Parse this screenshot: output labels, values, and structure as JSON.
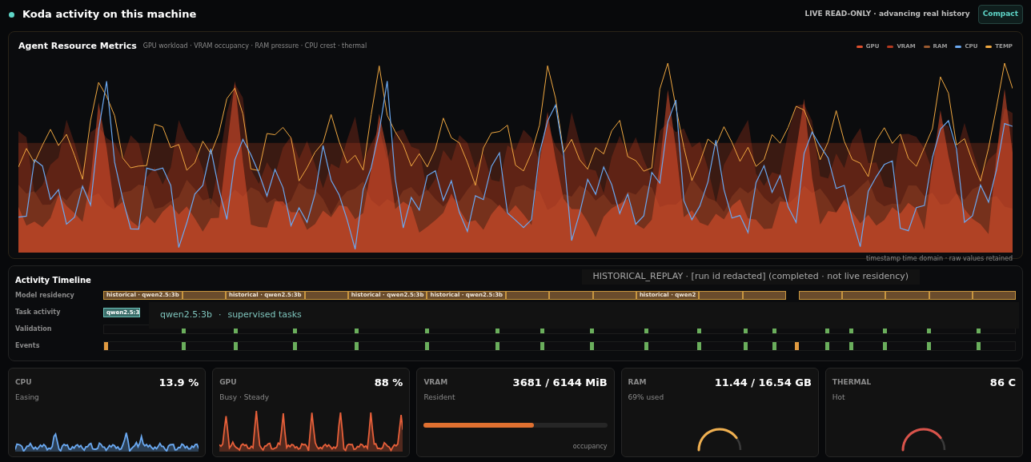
{
  "header": {
    "title": "Koda activity on this machine",
    "status": "LIVE READ-ONLY · advancing real history",
    "compact_button": "Compact"
  },
  "metrics": {
    "title": "Agent Resource Metrics",
    "subtitle": "GPU workload · VRAM occupancy · RAM pressure · CPU crest · thermal",
    "legend": [
      {
        "label": "GPU",
        "color": "#e0502e"
      },
      {
        "label": "VRAM",
        "color": "#b5391f"
      },
      {
        "label": "RAM",
        "color": "#9a5a30"
      },
      {
        "label": "CPU",
        "color": "#6aa8f0"
      },
      {
        "label": "TEMP",
        "color": "#f0a840"
      }
    ],
    "footnote": "timestamp time domain · raw values retained"
  },
  "timeline": {
    "title": "Activity Timeline",
    "replay_badge": "HISTORICAL_REPLAY · [run id redacted] (completed · not live residency)",
    "rows": [
      "Model residency",
      "Task activity",
      "Validation",
      "Events"
    ],
    "residency_segments": [
      {
        "kind": "labeled",
        "label": "historical · qwen2.5:3b"
      },
      {
        "kind": "plain"
      },
      {
        "kind": "labeled",
        "label": "historical · qwen2.5:3b"
      },
      {
        "kind": "plain"
      },
      {
        "kind": "labeled",
        "label": "historical · qwen2.5:3b"
      },
      {
        "kind": "labeled",
        "label": "historical · qwen2.5:3b"
      },
      {
        "kind": "plain"
      },
      {
        "kind": "plain"
      },
      {
        "kind": "plain"
      },
      {
        "kind": "labeled",
        "label": "historical · qwen2"
      },
      {
        "kind": "plain"
      },
      {
        "kind": "plain"
      }
    ],
    "residency_segments_after_gap": [
      {
        "kind": "plain"
      },
      {
        "kind": "plain"
      },
      {
        "kind": "plain"
      },
      {
        "kind": "plain"
      },
      {
        "kind": "plain"
      }
    ],
    "task_segment": "qwen2.5:3",
    "tooltip": {
      "model": "qwen2.5:3b",
      "separator": "·",
      "detail": "supervised tasks"
    }
  },
  "cards": [
    {
      "kind": "sparkline",
      "label": "CPU",
      "value": "13.9 %",
      "status": "Easing",
      "color": "#6aa8f0"
    },
    {
      "kind": "sparkline",
      "label": "GPU",
      "value": "88 %",
      "status": "Busy · Steady",
      "color": "#e8603a"
    },
    {
      "kind": "bar",
      "label": "VRAM",
      "value": "3681 / 6144 MiB",
      "status": "Resident",
      "color": "#e07030",
      "level": 0.6,
      "caption": "occupancy"
    },
    {
      "kind": "gauge",
      "label": "RAM",
      "value": "11.44 / 16.54 GB",
      "status": "69% used",
      "color": "#f0b050"
    },
    {
      "kind": "gauge",
      "label": "THERMAL",
      "value": "86 C",
      "status": "Hot",
      "color": "#d9534a"
    }
  ]
}
